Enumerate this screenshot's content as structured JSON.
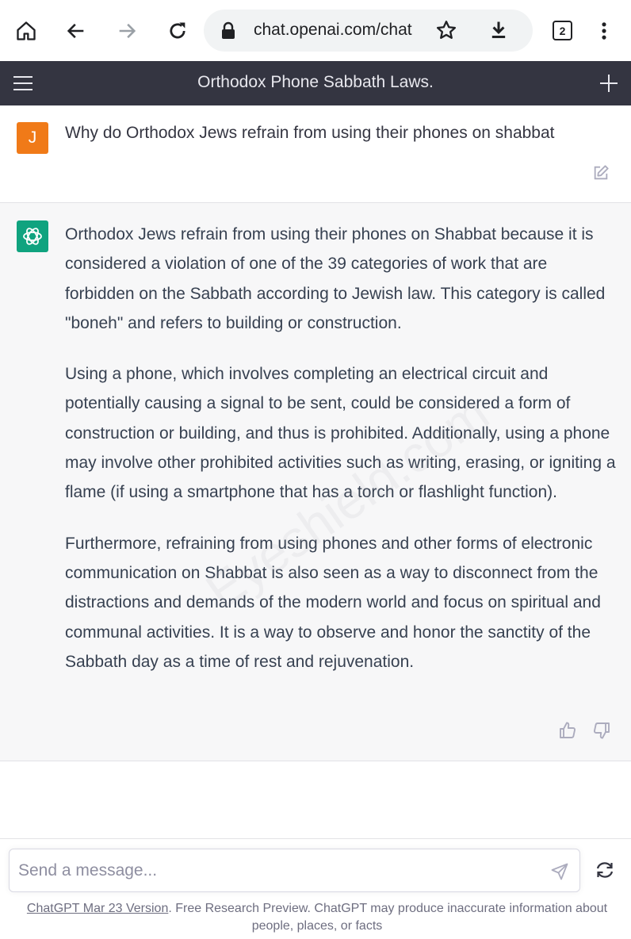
{
  "browser": {
    "url": "chat.openai.com/chat",
    "tab_count": "2"
  },
  "header": {
    "title": "Orthodox Phone Sabbath Laws."
  },
  "user_message": {
    "avatar_initial": "J",
    "text": "Why do Orthodox Jews refrain from using their phones on shabbat"
  },
  "assistant_message": {
    "paragraphs": [
      "Orthodox Jews refrain from using their phones on Shabbat because it is considered a violation of one of the 39 categories of work that are forbidden on the Sabbath according to Jewish law. This category is called \"boneh\" and refers to building or construction.",
      "Using a phone, which involves completing an electrical circuit and potentially causing a signal to be sent, could be considered a form of construction or building, and thus is prohibited. Additionally, using a phone may involve other prohibited activities such as writing, erasing, or igniting a flame (if using a smartphone that has a torch or flashlight function).",
      "Furthermore, refraining from using phones and other forms of electronic communication on Shabbat is also seen as a way to disconnect from the distractions and demands of the modern world and focus on spiritual and communal activities. It is a way to observe and honor the sanctity of the Sabbath day as a time of rest and rejuvenation."
    ],
    "watermark": "Eyeshield.com"
  },
  "composer": {
    "placeholder": "Send a message...",
    "footer_link": "ChatGPT Mar 23 Version",
    "footer_text": ". Free Research Preview. ChatGPT may produce inaccurate information about people, places, or facts"
  },
  "colors": {
    "header_bg": "#343541",
    "user_avatar": "#f07a18",
    "bot_avatar": "#10a37f",
    "bot_bg": "#f7f7f8"
  }
}
